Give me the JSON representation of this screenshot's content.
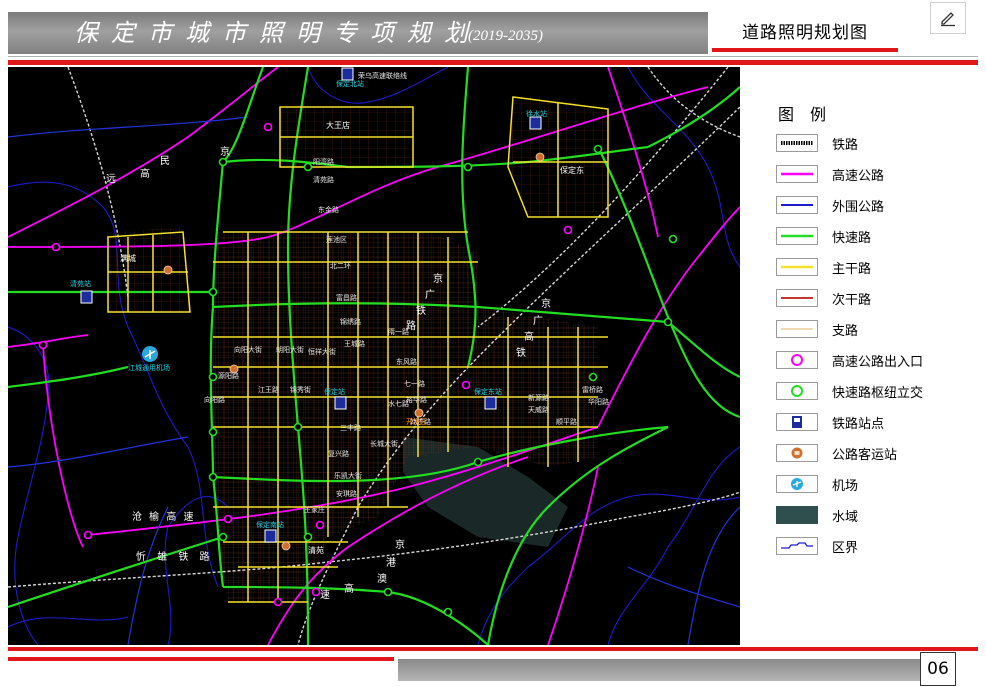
{
  "header": {
    "doc_title": "保定市城市照明专项规划",
    "years": "(2019-2035)",
    "sheet_title": "道路照明规划图"
  },
  "edit_icon": "pencil-icon",
  "page_number": "06",
  "legend": {
    "title": "图例",
    "items": [
      {
        "label": "铁路",
        "icon": "railway-line",
        "color": "#000000"
      },
      {
        "label": "高速公路",
        "icon": "expressway-line",
        "color": "#ff00ff"
      },
      {
        "label": "外围公路",
        "icon": "peripheral-road-line",
        "color": "#1c1ccc"
      },
      {
        "label": "快速路",
        "icon": "fast-road-line",
        "color": "#22dd22"
      },
      {
        "label": "主干路",
        "icon": "arterial-road-line",
        "color": "#f5e12b"
      },
      {
        "label": "次干路",
        "icon": "secondary-road-line",
        "color": "#c0392b"
      },
      {
        "label": "支路",
        "icon": "branch-road-line",
        "color": "#f0d9b0"
      },
      {
        "label": "高速公路出入口",
        "icon": "expressway-exit-ring",
        "color": "#ff00ff"
      },
      {
        "label": "快速路枢纽立交",
        "icon": "interchange-ring",
        "color": "#22dd22"
      },
      {
        "label": "铁路站点",
        "icon": "railway-station-icon",
        "color": "#1c2c9c"
      },
      {
        "label": "公路客运站",
        "icon": "bus-station-icon",
        "color": "#d07030"
      },
      {
        "label": "机场",
        "icon": "airport-icon",
        "color": "#29a8e0"
      },
      {
        "label": "水域",
        "icon": "water-swatch",
        "color": "#2f4f4f"
      },
      {
        "label": "区界",
        "icon": "district-boundary-line",
        "color": "#1c1ccc"
      }
    ]
  },
  "map": {
    "labels": {
      "dawangdian": "大王店",
      "zhuozhou_left": "京",
      "yuan": "远",
      "gao": "高",
      "min": "民",
      "jing_top": "京",
      "jing_rail": "京",
      "guang": "广",
      "tie": "铁",
      "lu": "路",
      "jing2": "京",
      "guang2": "广",
      "gao2": "高",
      "tie2": "铁",
      "cang_yu_gao_su": "沧 榆 高 速",
      "zhe_xi_tie_lu": "忻 雄 铁 路",
      "jing_bottom": "京",
      "gang": "港",
      "ao": "澳",
      "gao3": "高",
      "su3": "速",
      "rongcheng": "满城",
      "baoding_north_station": "保定北站",
      "baoding_station": "保定站",
      "baoding_east_station": "保定东站",
      "baoding_south_station": "保定南站",
      "jiangcheng_station": "清苑站",
      "xushui_station": "徐水站",
      "airport": "江城通用机场",
      "east_area": "保定东",
      "qingyuan": "清苑",
      "jingqin_line": "荣乌高速联络线",
      "yangwan": "阳湾路",
      "qingyuan_road": "清苑路",
      "lianchi": "莲池区",
      "xiangyang": "向阳大街",
      "chaoyang": "朝阳大街",
      "kaifa": "开发区",
      "dongfeng": "东风路",
      "yuhua": "裕华路",
      "hanzhang": "韩庄路",
      "jinxiu": "锦绣路",
      "changcheng": "长城大街",
      "sanfeng": "三丰路",
      "wangjiazhuang": "王家庄",
      "fuxing": "复兴路",
      "lejiang": "乐凯大街",
      "shunping": "顺平路",
      "xinyuan": "新源路",
      "tianwei": "天威路",
      "leiqiao": "雷桥路",
      "huayang": "华阳路",
      "yuanyang": "源阳路",
      "qiyi": "七一路",
      "hengxiang": "恒祥大街",
      "shuiyi": "隋一路",
      "jiangwang": "江王路",
      "fuchang": "富昌路",
      "jinxiu2": "锦秀街",
      "wangcheng": "王城路",
      "dongjin": "东金路",
      "shuiqi": "水七路",
      "beier": "北二环",
      "anqi": "安琪路",
      "xiangyang2": "向阳路"
    }
  }
}
